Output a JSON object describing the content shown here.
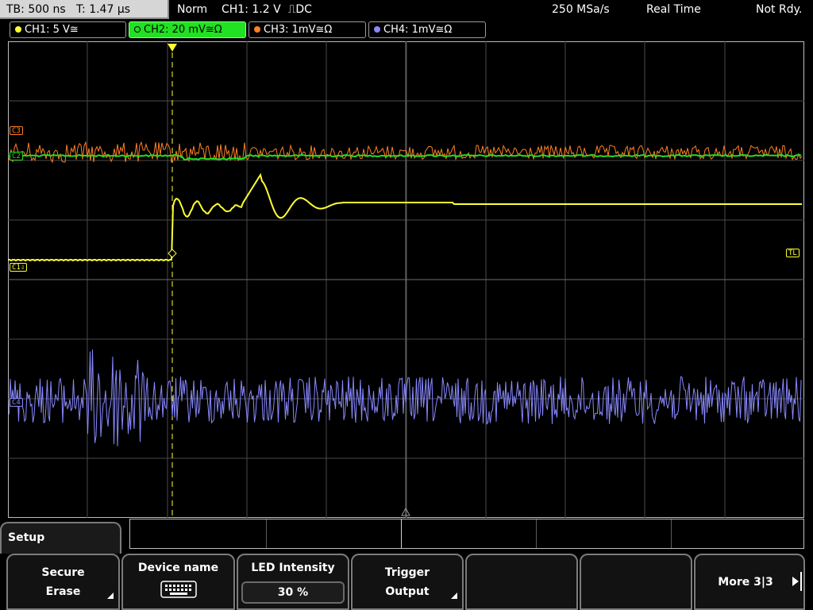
{
  "status": {
    "timebase": "TB: 500 ns   T: 1.47 µs",
    "mode": "Norm",
    "trigger": "CH1: 1.2 V  ⎍DC",
    "sample_rate": "250 MSa/s",
    "acq_mode": "Real Time",
    "run_state": "Not Rdy."
  },
  "channels": [
    {
      "label": "CH1: 5 V≅",
      "color": "#ffff33"
    },
    {
      "label": "CH2: 20 mV≅Ω",
      "color": "#22e022"
    },
    {
      "label": "CH3: 1mV≅Ω",
      "color": "#ff7f24"
    },
    {
      "label": "CH4: 1mV≅Ω",
      "color": "#8888ff"
    }
  ],
  "markers": {
    "ch1": "C1⇩",
    "ch2": "C2",
    "ch3": "C3",
    "ch4": "C4",
    "trigger_level": "TL"
  },
  "menu": {
    "title": "Setup",
    "softkeys": [
      {
        "line1": "Secure",
        "line2": "Erase"
      },
      {
        "line1": "Device name",
        "icon": "keyboard-icon"
      },
      {
        "line1": "LED Intensity",
        "value": "30 %"
      },
      {
        "line1": "Trigger",
        "line2": "Output"
      },
      {
        "line1": ""
      },
      {
        "line1": ""
      },
      {
        "line1": "More 3|3"
      }
    ]
  }
}
